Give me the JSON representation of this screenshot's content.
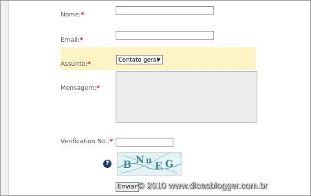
{
  "form": {
    "name_label": "Nome:",
    "email_label": "Email:",
    "subject_label": "Assunto:",
    "subject_selected": "Contato geral",
    "message_label": "Mensagem:",
    "verification_label": "Verification No.:",
    "required_marker": "*",
    "help_icon": "?",
    "captcha_chars": [
      "B",
      "N",
      "u",
      "E",
      "G"
    ],
    "submit_label": "Enviar"
  },
  "watermark": "© 2010 www.dicasblogger.com.br",
  "colors": {
    "required": "#e00000",
    "highlight": "#fdf3c4",
    "captcha": "#3b8c8e"
  }
}
